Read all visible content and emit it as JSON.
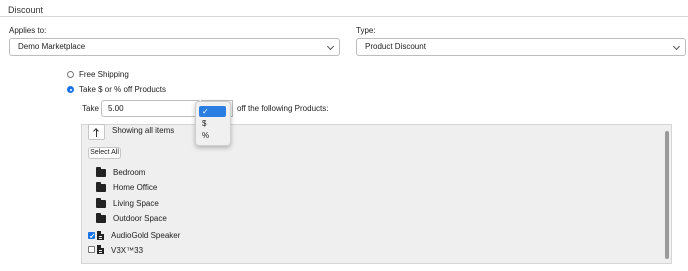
{
  "section": {
    "title": "Discount"
  },
  "applies_to": {
    "label": "Applies to:",
    "value": "Demo Marketplace"
  },
  "type": {
    "label": "Type:",
    "value": "Product Discount"
  },
  "options": {
    "free_shipping": "Free Shipping",
    "take_off": "Take $ or % off Products"
  },
  "take": {
    "prefix": "Take",
    "amount": "5.00",
    "suffix": "off the following Products:",
    "unit_options": [
      "✓",
      "$",
      "%"
    ]
  },
  "browser": {
    "showing": "Showing all items",
    "select_all": "Select All",
    "folders": [
      "Bedroom",
      "Home Office",
      "Living Space",
      "Outdoor Space"
    ],
    "products": [
      {
        "name": "AudioGold Speaker",
        "checked": true
      },
      {
        "name": "V3X™33",
        "checked": false
      }
    ]
  },
  "colors": {
    "accent": "#1a73e8",
    "highlight": "#2a7de1"
  },
  "icons": [
    "chevron-down-icon",
    "up-arrow-icon",
    "folder-icon",
    "file-icon",
    "checkmark-icon"
  ]
}
